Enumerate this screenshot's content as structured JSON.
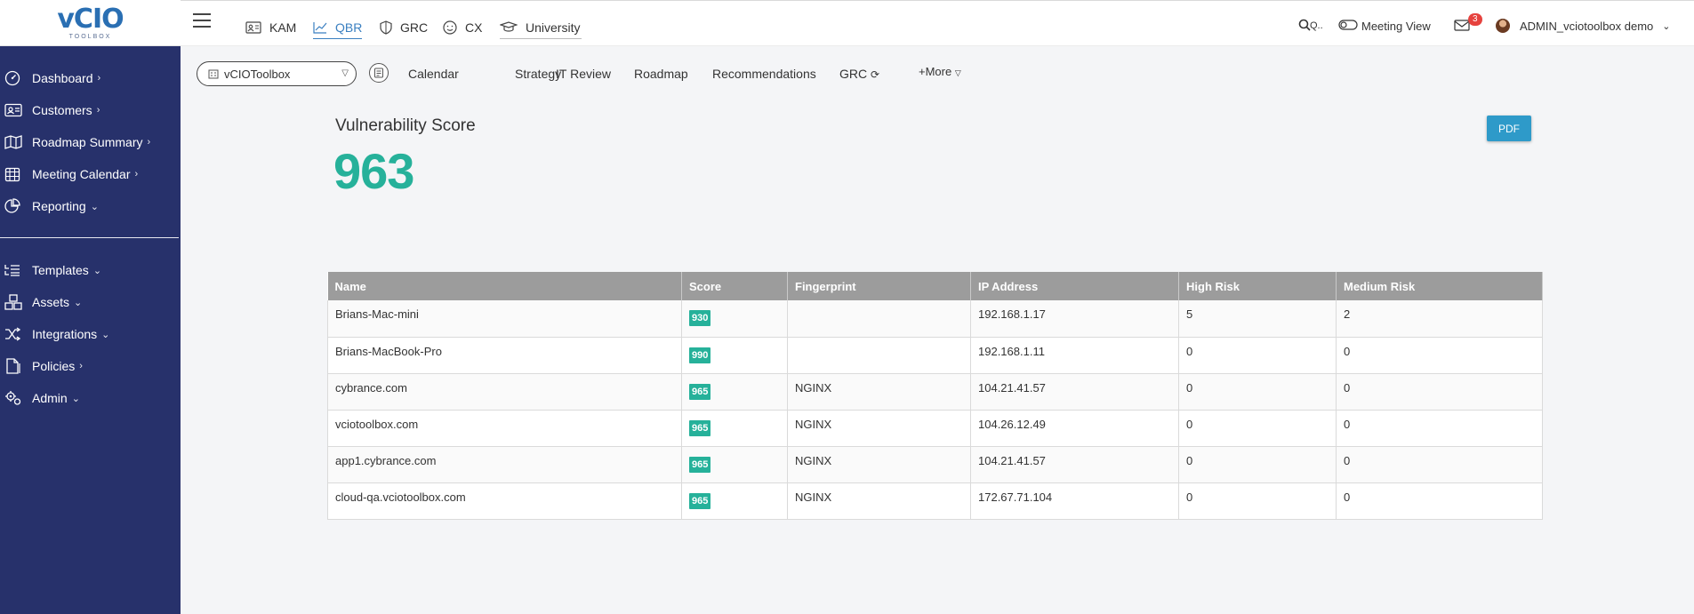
{
  "logo": {
    "main": "vCIO",
    "sub": "TOOLBOX"
  },
  "sidebar": {
    "items": [
      {
        "label": "Dashboard",
        "arrow": "›"
      },
      {
        "label": "Customers",
        "arrow": "›"
      },
      {
        "label": "Roadmap Summary",
        "arrow": "›"
      },
      {
        "label": "Meeting Calendar",
        "arrow": "›"
      },
      {
        "label": "Reporting",
        "arrow": "⌄"
      },
      {
        "label": "Templates",
        "arrow": "⌄"
      },
      {
        "label": "Assets",
        "arrow": "⌄"
      },
      {
        "label": "Integrations",
        "arrow": "⌄"
      },
      {
        "label": "Policies",
        "arrow": "›"
      },
      {
        "label": "Admin",
        "arrow": "⌄"
      }
    ]
  },
  "topnav": {
    "tabs": [
      "KAM",
      "QBR",
      "GRC",
      "CX",
      "University"
    ],
    "search_label": "Q..",
    "meeting_view": "Meeting View",
    "notification_count": "3",
    "user": "ADMIN_vciotoolbox demo"
  },
  "subnav": {
    "org_selected": "vCIOToolbox",
    "tabs": [
      "Calendar",
      "Strategy",
      "IT Review",
      "Roadmap",
      "Recommendations",
      "GRC",
      "+More"
    ]
  },
  "main": {
    "score_label": "Vulnerability Score",
    "score_value": "963",
    "pdf_label": "PDF"
  },
  "table": {
    "headers": [
      "Name",
      "Score",
      "Fingerprint",
      "IP Address",
      "High Risk",
      "Medium Risk"
    ],
    "rows": [
      {
        "name": "Brians-Mac-mini",
        "score": "930",
        "fingerprint": "",
        "ip": "192.168.1.17",
        "high": "5",
        "medium": "2"
      },
      {
        "name": "Brians-MacBook-Pro",
        "score": "990",
        "fingerprint": "",
        "ip": "192.168.1.11",
        "high": "0",
        "medium": "0"
      },
      {
        "name": "cybrance.com",
        "score": "965",
        "fingerprint": "NGINX",
        "ip": "104.21.41.57",
        "high": "0",
        "medium": "0"
      },
      {
        "name": "vciotoolbox.com",
        "score": "965",
        "fingerprint": "NGINX",
        "ip": "104.26.12.49",
        "high": "0",
        "medium": "0"
      },
      {
        "name": "app1.cybrance.com",
        "score": "965",
        "fingerprint": "NGINX",
        "ip": "104.21.41.57",
        "high": "0",
        "medium": "0"
      },
      {
        "name": "cloud-qa.vciotoolbox.com",
        "score": "965",
        "fingerprint": "NGINX",
        "ip": "172.67.71.104",
        "high": "0",
        "medium": "0"
      }
    ]
  },
  "colors": {
    "sidebar": "#27316b",
    "accent": "#26b19a",
    "link": "#3a7fc0",
    "pdf": "#2e9ac9",
    "badge": "#e6423e"
  }
}
